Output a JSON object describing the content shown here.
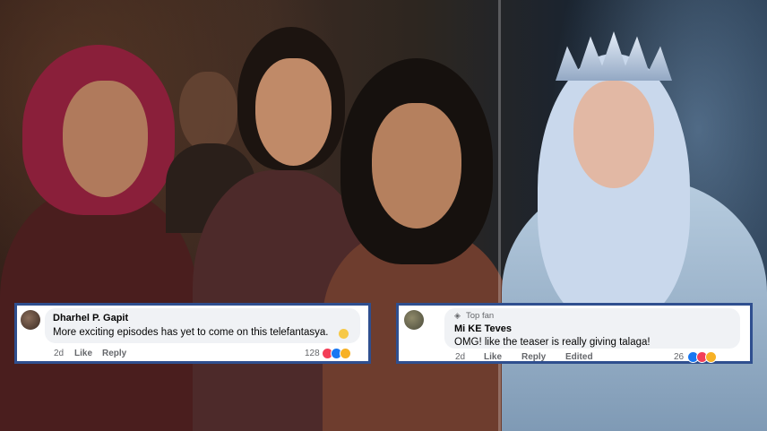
{
  "comments": [
    {
      "author": "Dharhel P. Gapit",
      "text": "More exciting episodes has yet to come on this telefantasya.",
      "time": "2d",
      "like_label": "Like",
      "reply_label": "Reply",
      "reaction_count": "128",
      "reactions": [
        "heart-icon",
        "like-icon",
        "care-icon"
      ]
    },
    {
      "badge": "Top fan",
      "author": "Mi KE Teves",
      "text": "OMG! like the teaser is really giving talaga!",
      "time": "2d",
      "like_label": "Like",
      "reply_label": "Reply",
      "edited_label": "Edited",
      "reaction_count": "26",
      "reactions": [
        "like-icon",
        "heart-icon",
        "care-icon"
      ]
    }
  ],
  "colors": {
    "card_border": "#2f4f8f",
    "like_blue": "#1877f2",
    "heart_red": "#f33e58",
    "care_yellow": "#f7b125"
  }
}
